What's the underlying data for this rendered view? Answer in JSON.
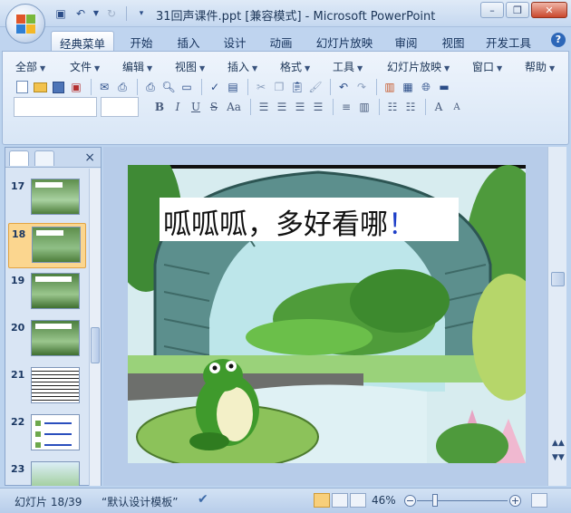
{
  "window": {
    "title": "31回声课件.ppt [兼容模式] - Microsoft PowerPoint",
    "minimize_icon": "minimize-icon",
    "maximize_icon": "restore-icon",
    "close_icon": "close-icon"
  },
  "ribbon_tabs": [
    "经典菜单",
    "开始",
    "插入",
    "设计",
    "动画",
    "幻灯片放映",
    "审阅",
    "视图",
    "开发工具"
  ],
  "menus": [
    "全部",
    "文件",
    "编辑",
    "视图",
    "插入",
    "格式",
    "工具",
    "幻灯片放映",
    "窗口",
    "帮助"
  ],
  "formatting": {
    "bold": "B",
    "italic": "I",
    "underline": "U",
    "strike": "S",
    "case": "Aa",
    "grow": "A",
    "shrink": "A"
  },
  "slides_panel": {
    "tabs": [
      "slides-tab",
      "outline-tab"
    ],
    "close": "×",
    "items": [
      {
        "number": "17"
      },
      {
        "number": "18",
        "selected": true
      },
      {
        "number": "19"
      },
      {
        "number": "20"
      },
      {
        "number": "21"
      },
      {
        "number": "22"
      },
      {
        "number": "23"
      }
    ]
  },
  "slide": {
    "title": "呱呱呱，多好看哪",
    "exclaim": "！"
  },
  "status_bar": {
    "slide_position": "幻灯片 18/39",
    "theme": "“默认设计模板”",
    "zoom": "46%",
    "zoom_percent": 46
  },
  "colors": {
    "accent": "#2d67b8",
    "selected_slide": "#fbd68f",
    "exclaim": "#1e3fc8"
  }
}
